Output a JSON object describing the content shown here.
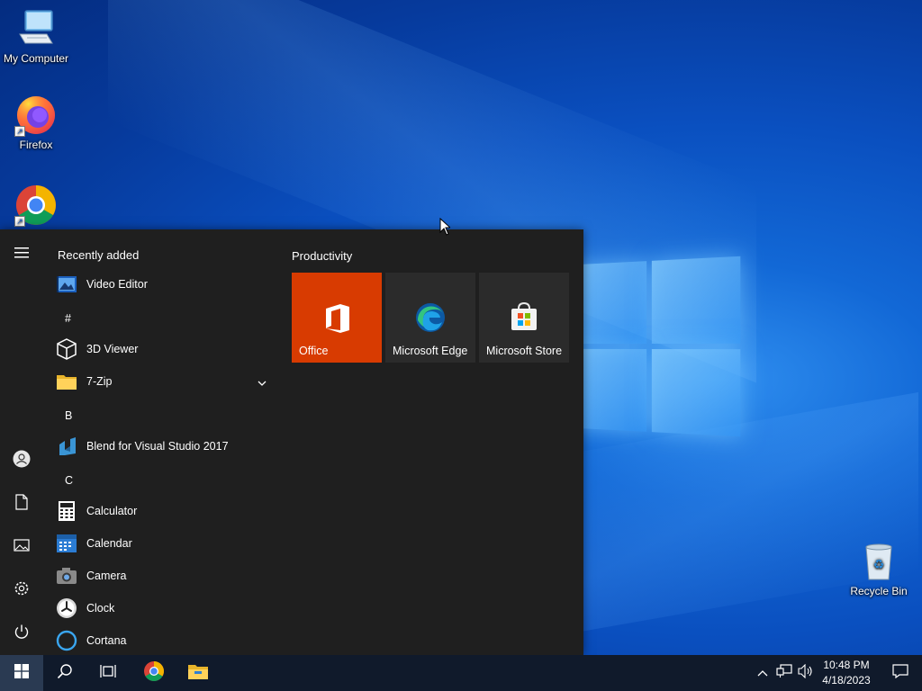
{
  "desktop": {
    "icons": [
      {
        "label": "My Computer",
        "icon": "computer-icon"
      },
      {
        "label": "Firefox",
        "icon": "firefox-icon"
      },
      {
        "label": "",
        "icon": "chrome-icon"
      },
      {
        "label": "Recycle Bin",
        "icon": "recycle-bin-icon"
      }
    ]
  },
  "start_menu": {
    "recently_added_header": "Recently added",
    "recent": [
      {
        "label": "Video Editor",
        "icon": "video-editor-icon"
      }
    ],
    "groups": [
      {
        "letter": "#",
        "apps": [
          {
            "label": "3D Viewer",
            "icon": "cube-icon"
          },
          {
            "label": "7-Zip",
            "icon": "folder-icon",
            "expandable": true
          }
        ]
      },
      {
        "letter": "B",
        "apps": [
          {
            "label": "Blend for Visual Studio 2017",
            "icon": "blend-icon"
          }
        ]
      },
      {
        "letter": "C",
        "apps": [
          {
            "label": "Calculator",
            "icon": "calculator-icon"
          },
          {
            "label": "Calendar",
            "icon": "calendar-icon"
          },
          {
            "label": "Camera",
            "icon": "camera-icon"
          },
          {
            "label": "Clock",
            "icon": "clock-icon"
          },
          {
            "label": "Cortana",
            "icon": "cortana-icon"
          }
        ]
      }
    ],
    "tiles_header": "Productivity",
    "tiles": [
      {
        "label": "Office",
        "icon": "office-icon",
        "color": "#d83b01"
      },
      {
        "label": "Microsoft Edge",
        "icon": "edge-icon",
        "color": "#2b2b2b"
      },
      {
        "label": "Microsoft Store",
        "icon": "store-icon",
        "color": "#2b2b2b"
      }
    ],
    "rail": [
      "hamburger-icon",
      "user-icon",
      "documents-icon",
      "pictures-icon",
      "settings-icon",
      "power-icon"
    ]
  },
  "taskbar": {
    "clock_time": "10:48 PM",
    "clock_date": "4/18/2023"
  }
}
